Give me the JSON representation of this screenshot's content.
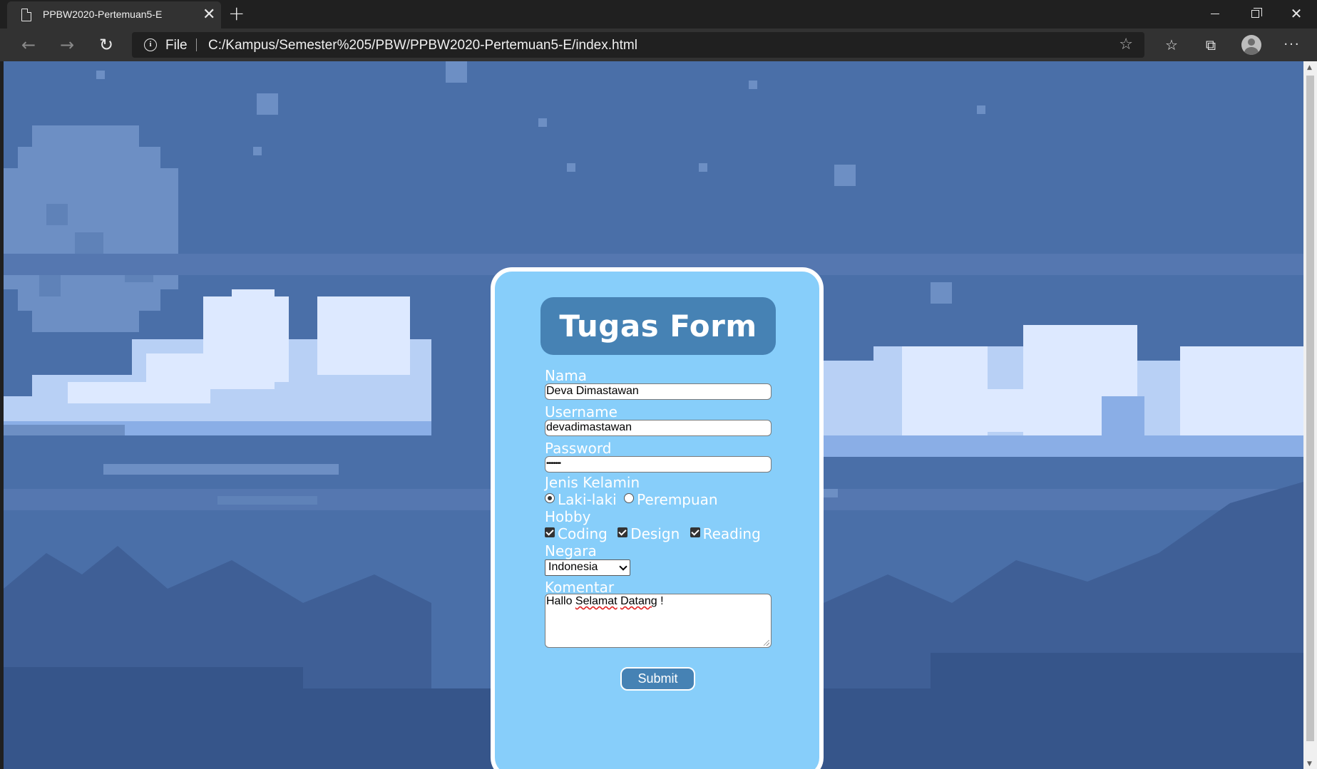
{
  "browser": {
    "tab_title": "PPBW2020-Pertemuan5-E",
    "tab_close": "✕",
    "new_tab": "+",
    "address": {
      "scheme_label": "File",
      "url": "C:/Kampus/Semester%205/PBW/PPBW2020-Pertemuan5-E/index.html"
    },
    "icons": [
      "page-icon",
      "close-icon",
      "plus-icon",
      "back-icon",
      "forward-icon",
      "reload-icon",
      "info-icon",
      "star-icon",
      "favorites-icon",
      "collections-icon",
      "profile-icon",
      "more-icon",
      "minimize-icon",
      "maximize-icon",
      "close-window-icon"
    ]
  },
  "colors": {
    "page_bg": "#4a6fa8",
    "card_bg": "#87cefa",
    "accent": "#4682b4",
    "card_border": "#ffffff"
  },
  "form": {
    "title": "Tugas Form",
    "nama": {
      "label": "Nama",
      "value": "Deva Dimastawan"
    },
    "username": {
      "label": "Username",
      "value": "devadimastawan"
    },
    "password": {
      "label": "Password",
      "value": "••••••••"
    },
    "gender": {
      "label": "Jenis Kelamin",
      "options": [
        {
          "label": "Laki-laki",
          "checked": true
        },
        {
          "label": "Perempuan",
          "checked": false
        }
      ]
    },
    "hobby": {
      "label": "Hobby",
      "options": [
        {
          "label": "Coding",
          "checked": true
        },
        {
          "label": "Design",
          "checked": true
        },
        {
          "label": "Reading",
          "checked": true
        }
      ]
    },
    "negara": {
      "label": "Negara",
      "selected": "Indonesia"
    },
    "komentar": {
      "label": "Komentar",
      "value_parts": [
        "Hallo ",
        "Selamat",
        " ",
        "Datang",
        " !"
      ]
    },
    "submit_label": "Submit"
  }
}
